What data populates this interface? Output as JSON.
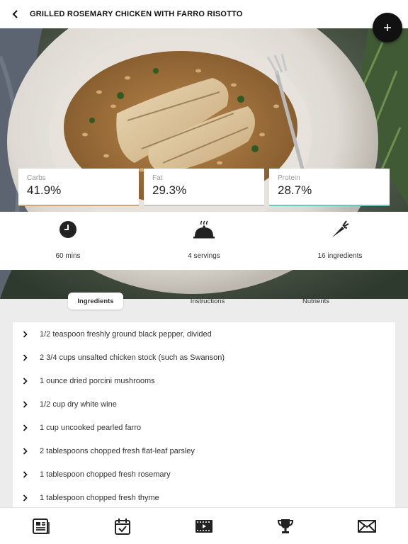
{
  "header": {
    "title": "GRILLED ROSEMARY CHICKEN WITH FARRO RISOTTO",
    "back_icon": "chevron-left-icon",
    "add_icon": "plus-icon"
  },
  "macros": {
    "carbs": {
      "label": "Carbs",
      "value": "41.9%"
    },
    "fat": {
      "label": "Fat",
      "value": "29.3%"
    },
    "protein": {
      "label": "Protein",
      "value": "28.7%"
    }
  },
  "stats": {
    "time": {
      "icon": "clock-icon",
      "label": "60 mins"
    },
    "servings": {
      "icon": "serving-cloche-icon",
      "label": "4 servings"
    },
    "ingredients": {
      "icon": "carrot-icon",
      "label": "16 ingredients"
    }
  },
  "tabs": [
    {
      "label": "Ingredients",
      "active": true
    },
    {
      "label": "Instructions",
      "active": false
    },
    {
      "label": "Nutrients",
      "active": false
    }
  ],
  "ingredients": [
    "1/2 teaspoon freshly ground black pepper, divided",
    "2 3/4 cups unsalted chicken stock (such as Swanson)",
    "1 ounce dried porcini mushrooms",
    "1/2 cup dry white wine",
    "1 cup uncooked pearled farro",
    "2 tablespoons chopped fresh flat-leaf parsley",
    "1 tablespoon chopped fresh rosemary",
    "1 tablespoon chopped fresh thyme"
  ],
  "bottom_nav": [
    {
      "icon": "recipes-icon"
    },
    {
      "icon": "checklist-icon"
    },
    {
      "icon": "video-icon"
    },
    {
      "icon": "trophy-icon"
    },
    {
      "icon": "mail-icon"
    }
  ],
  "colors": {
    "accent_carbs": "#c9a77a",
    "accent_fat": "#c6c6c6",
    "accent_protein": "#6cc7c4",
    "fab": "#111111"
  }
}
